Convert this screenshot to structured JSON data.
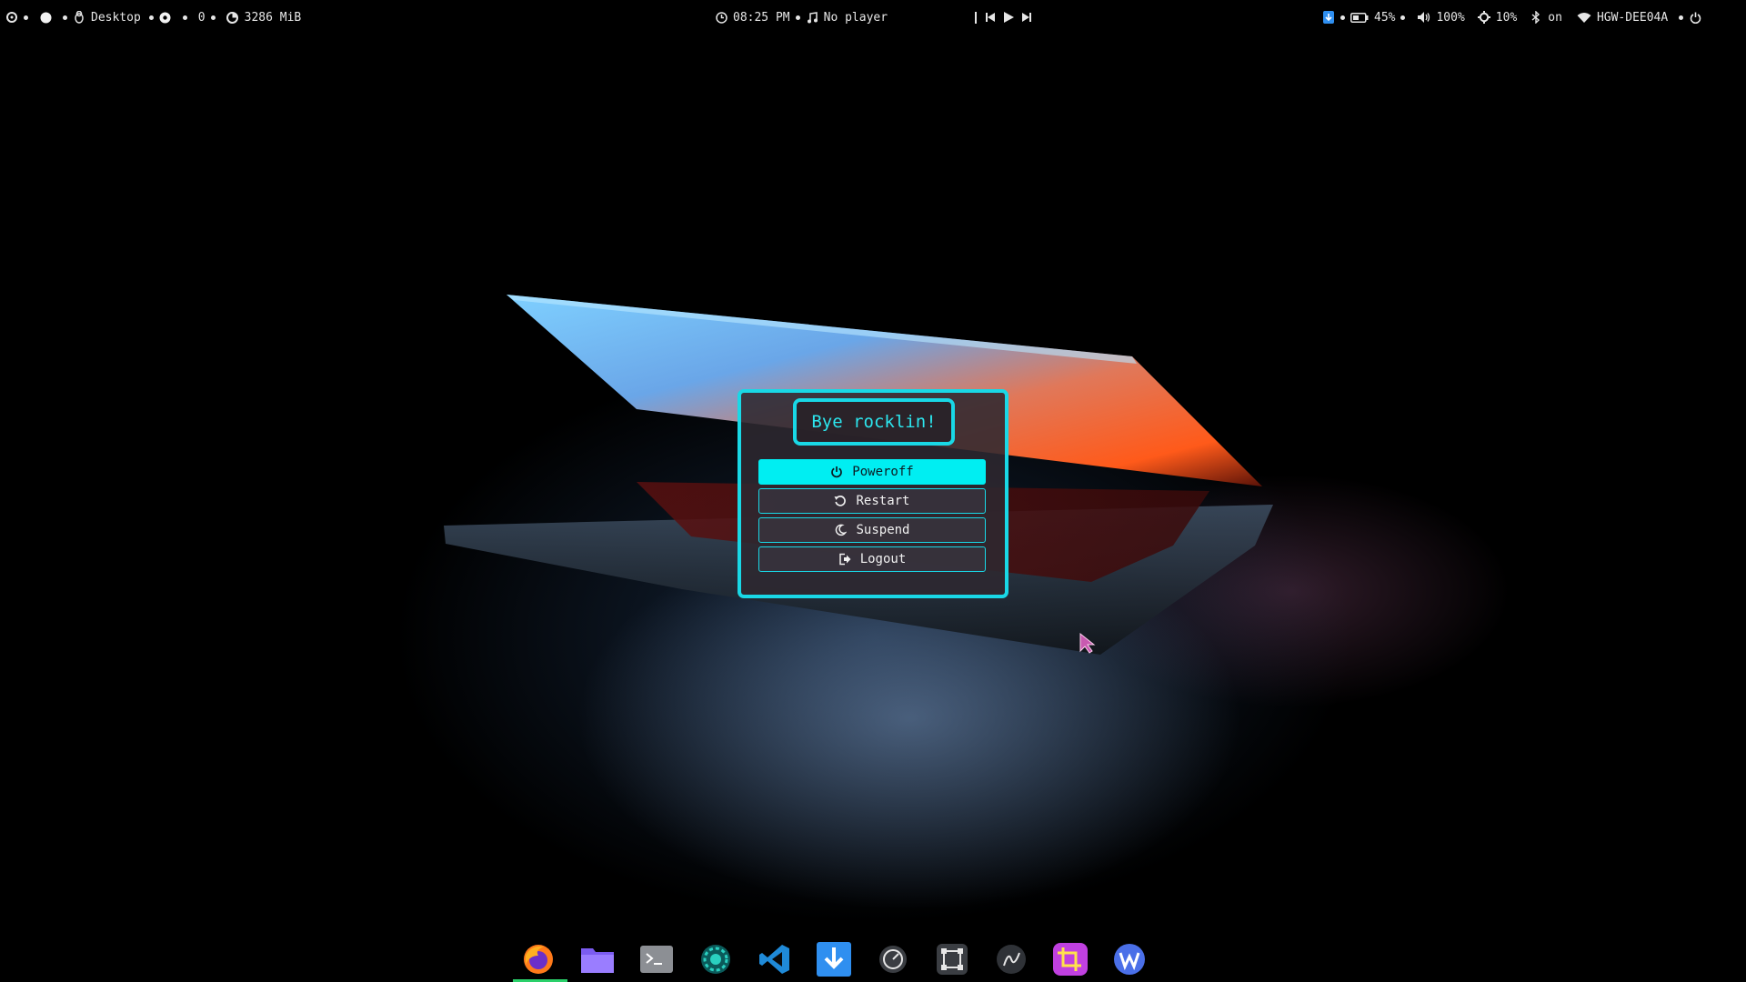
{
  "topbar": {
    "workspace_label": "Desktop",
    "counter": "0",
    "memory": "3286 MiB",
    "clock": "08:25 PM",
    "player": "No player",
    "battery": "45%",
    "volume": "100%",
    "brightness": "10%",
    "bluetooth": "on",
    "wifi": "HGW-DEE04A"
  },
  "dialog": {
    "greeting": "Bye rocklin!",
    "buttons": [
      {
        "label": "Poweroff",
        "icon": "power-icon",
        "active": true
      },
      {
        "label": "Restart",
        "icon": "restart-icon",
        "active": false
      },
      {
        "label": "Suspend",
        "icon": "moon-icon",
        "active": false
      },
      {
        "label": "Logout",
        "icon": "logout-icon",
        "active": false
      }
    ]
  },
  "dock": {
    "apps": [
      "firefox-icon",
      "files-icon",
      "terminal-icon",
      "obs-icon",
      "vscode-icon",
      "downloader-icon",
      "speedometer-icon",
      "screenshot-icon",
      "inkscape-icon",
      "crop-icon",
      "wps-writer-icon"
    ]
  },
  "colors": {
    "accent": "#19d8e6",
    "active_button": "#00eef2",
    "dock_indicator": "#2ad06a"
  }
}
